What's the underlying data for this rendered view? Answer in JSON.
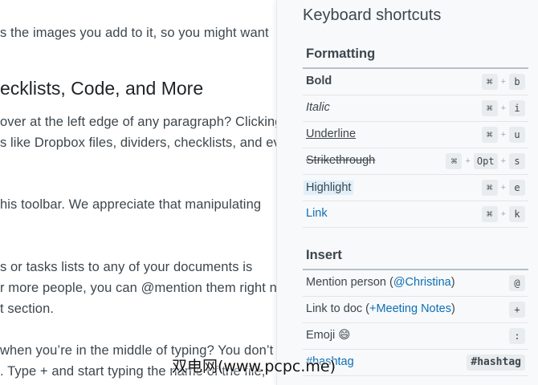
{
  "document": {
    "lines": [
      "s the images you add to it, so you might want",
      "over at the left edge of any paragraph? Clicking",
      "s like Dropbox files, dividers, checklists, and ev",
      "his toolbar. We appreciate that manipulating",
      "s or tasks lists to any of your documents is",
      "r more people, you can @mention them right n",
      "t section.",
      "when you’re in the middle of typing? You don’t",
      ". Type + and start typing the name of the file,"
    ],
    "heading": "ecklists, Code, and More"
  },
  "panel": {
    "title": "Keyboard shortcuts",
    "formatting": {
      "title": "Formatting",
      "rows": [
        {
          "label": "Bold",
          "keys": [
            "⌘",
            "b"
          ]
        },
        {
          "label": "Italic",
          "keys": [
            "⌘",
            "i"
          ]
        },
        {
          "label": "Underline",
          "keys": [
            "⌘",
            "u"
          ]
        },
        {
          "label": "Strikethrough",
          "keys": [
            "⌘",
            "Opt",
            "s"
          ]
        },
        {
          "label": "Highlight",
          "keys": [
            "⌘",
            "e"
          ]
        },
        {
          "label": "Link",
          "keys": [
            "⌘",
            "k"
          ]
        }
      ],
      "plus": "+"
    },
    "insert": {
      "title": "Insert",
      "mention": {
        "prefix": "Mention person (",
        "link": "@Christina",
        "suffix": ")",
        "key": "@"
      },
      "doclink": {
        "prefix": "Link to doc (",
        "plus": "+",
        "link": "Meeting Notes",
        "suffix": ")",
        "key": "+"
      },
      "emoji": {
        "label": "Emoji",
        "glyph": "😄",
        "key": ":"
      },
      "hashtag": {
        "label": "#hashtag",
        "key": "#hashtag"
      }
    }
  },
  "watermark": "双电网(www.pcpc.me)"
}
